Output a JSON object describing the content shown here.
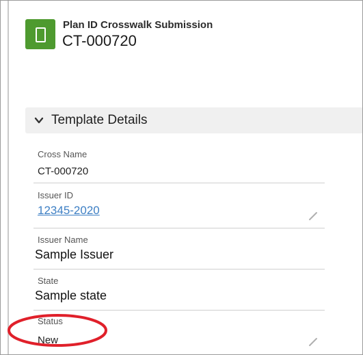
{
  "header": {
    "object_label": "Plan ID Crosswalk Submission",
    "record_title": "CT-000720",
    "icon": "phone-icon",
    "icon_color": "#4e9a2f"
  },
  "section": {
    "title": "Template Details",
    "icon": "chevron-down-icon"
  },
  "fields": {
    "cross_name": {
      "label": "Cross Name",
      "value": "CT-000720"
    },
    "issuer_id": {
      "label": "Issuer ID",
      "value": "12345-2020"
    },
    "issuer_name": {
      "label": "Issuer Name",
      "value": "Sample Issuer"
    },
    "state": {
      "label": "State",
      "value": "Sample state"
    },
    "status": {
      "label": "Status",
      "value": "New"
    }
  },
  "annotation": {
    "color": "#e0202a"
  }
}
